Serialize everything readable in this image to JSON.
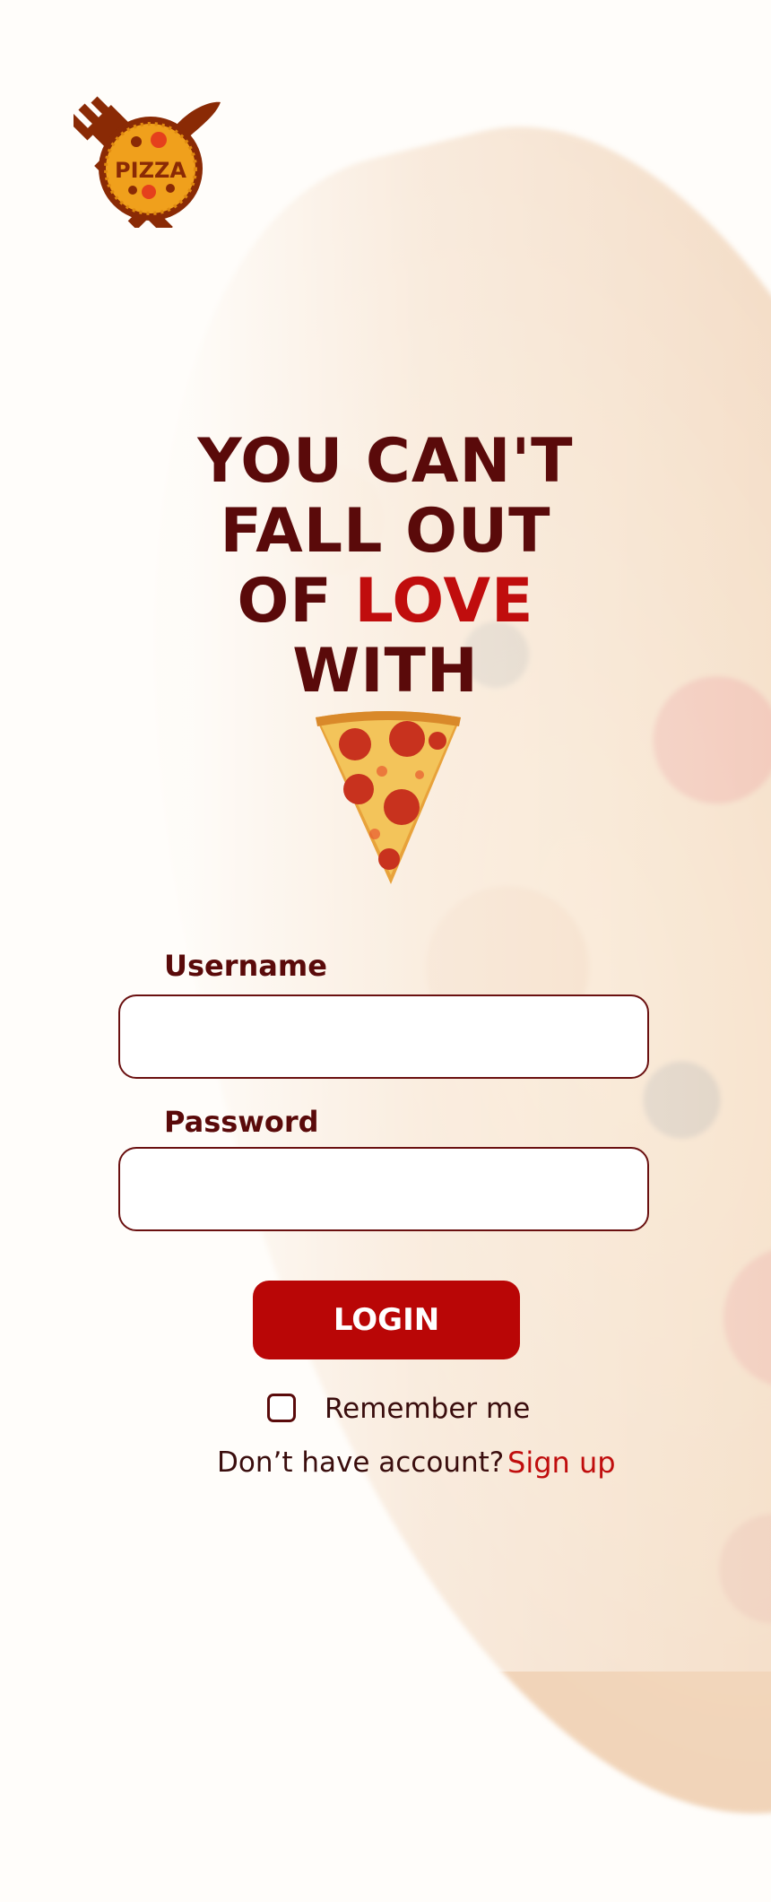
{
  "brand": {
    "logo_text": "PIZZA",
    "colors": {
      "primary_dark": "#5a0a0a",
      "accent_red": "#c00d0d",
      "button_red": "#b90606",
      "logo_orange": "#f0a01c"
    }
  },
  "hero": {
    "line1": "YOU CAN'T",
    "line2": "FALL OUT",
    "line3_prefix": "OF ",
    "line3_highlight": "LOVE",
    "line4": "WITH",
    "image_icon": "pizza-slice-icon"
  },
  "form": {
    "username_label": "Username",
    "username_value": "",
    "password_label": "Password",
    "password_value": "",
    "login_label": "LOGIN",
    "remember_label": "Remember me",
    "remember_checked": false,
    "no_account_text": "Don’t have account?",
    "signup_label": "Sign up"
  }
}
